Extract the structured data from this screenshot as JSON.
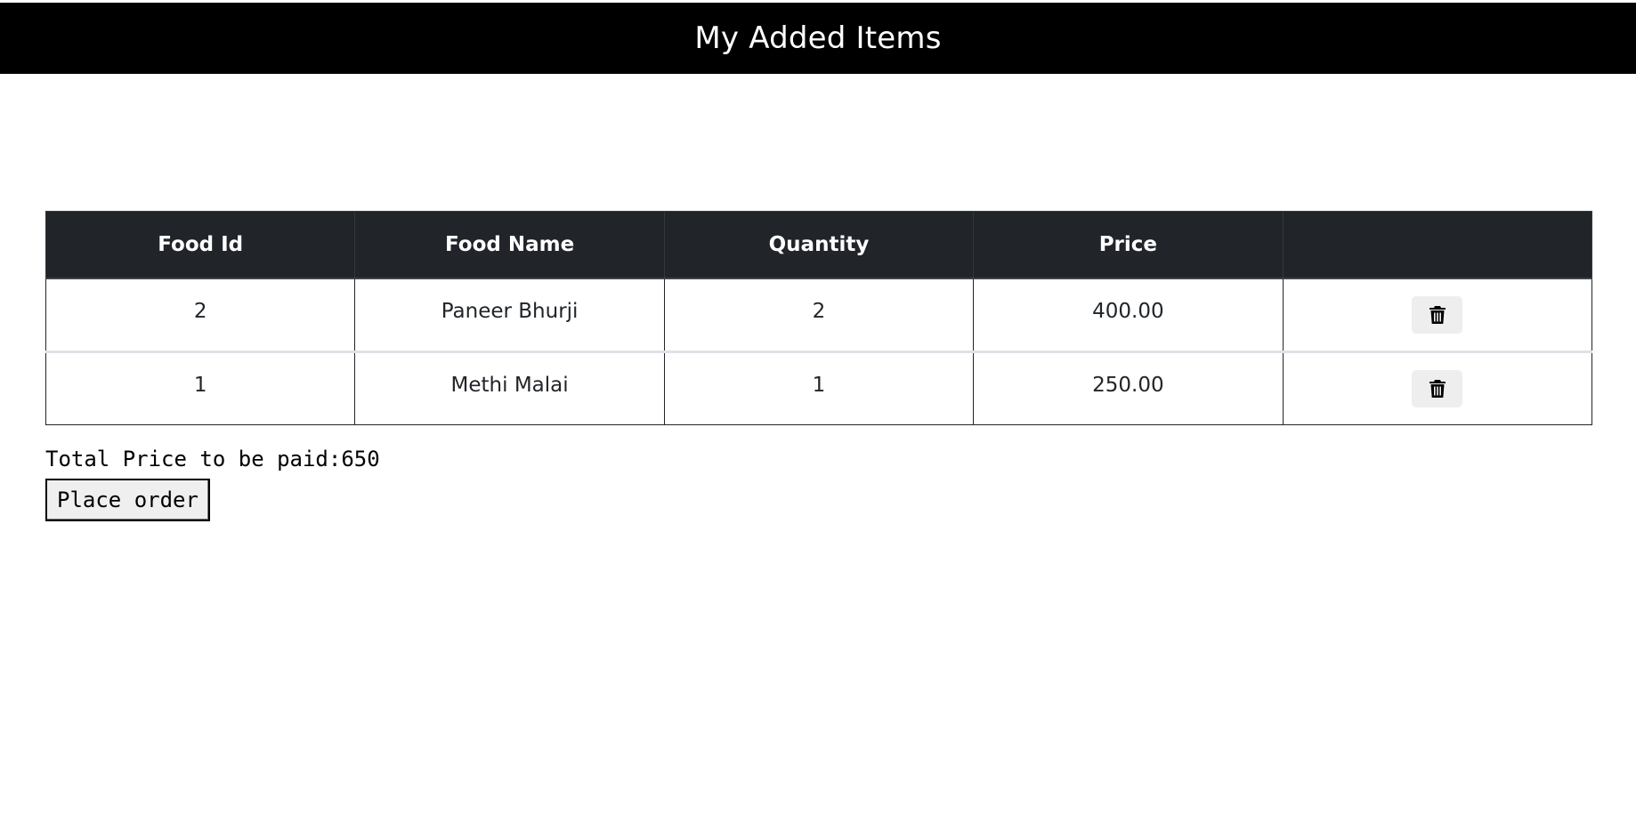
{
  "header": {
    "title": "My Added Items"
  },
  "table": {
    "columns": [
      "Food Id",
      "Food Name",
      "Quantity",
      "Price",
      ""
    ],
    "rows": [
      {
        "food_id": "2",
        "food_name": "Paneer Bhurji",
        "quantity": "2",
        "price": "400.00",
        "action_icon": "trash-icon"
      },
      {
        "food_id": "1",
        "food_name": "Methi Malai",
        "quantity": "1",
        "price": "250.00",
        "action_icon": "trash-icon"
      }
    ]
  },
  "summary": {
    "total_text": "Total Price to be paid:650",
    "place_order_label": "Place order"
  },
  "colors": {
    "header_bg": "#000000",
    "table_header_bg": "#212529",
    "delete_button_bg": "#eeeeee"
  }
}
